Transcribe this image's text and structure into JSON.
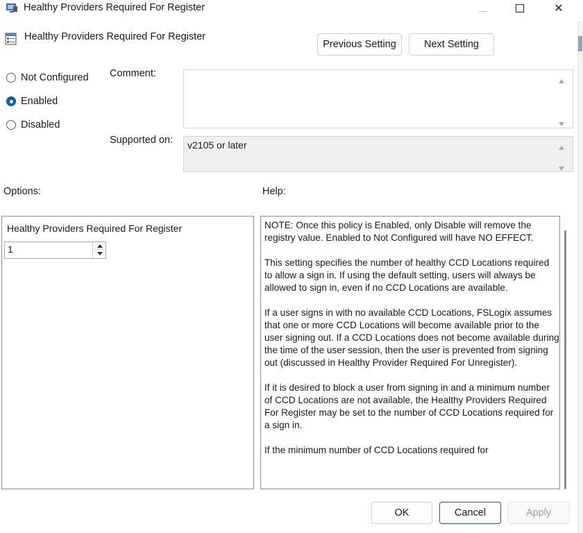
{
  "window": {
    "title": "Healthy Providers Required For Register",
    "icon": "policy-editor-icon",
    "controls": {
      "minimize_icon": "minimize-icon",
      "maximize_icon": "maximize-icon",
      "close_glyph": "✕"
    }
  },
  "header": {
    "policy_title": "Healthy Providers Required For Register",
    "policy_icon": "policy-setting-icon",
    "previous_label": "Previous Setting",
    "next_label": "Next Setting"
  },
  "state": {
    "options": [
      {
        "label": "Not Configured",
        "checked": false
      },
      {
        "label": "Enabled",
        "checked": true
      },
      {
        "label": "Disabled",
        "checked": false
      }
    ]
  },
  "comment": {
    "label": "Comment:",
    "value": ""
  },
  "supported": {
    "label": "Supported on:",
    "value": "v2105 or later"
  },
  "options_pane": {
    "label": "Options:",
    "field_label": "Healthy Providers Required For Register",
    "value": "1"
  },
  "help_pane": {
    "label": "Help:",
    "paragraphs": [
      "NOTE:  Once this policy is Enabled, only Disable will remove the registry value. Enabled to Not Configured will have NO EFFECT.",
      "This setting specifies the number of healthy CCD Locations required to allow a sign in. If using the default setting, users will always be allowed to sign in, even if no CCD Locations are available.",
      "If a user signs in with no available CCD Locations, FSLogix assumes that one or more CCD Locations will become available prior to the user signing out. If a CCD Locations does not become available during the time of the user session, then the user is prevented from signing out (discussed in Healthy Provider Required For Unregister).",
      "If it is desired to block a user from signing in and a minimum number of CCD Locations are not available, the Healthy Providers Required For Register may be set to the number of CCD Locations required for a sign in.",
      "If the minimum number of CCD Locations required for"
    ]
  },
  "footer": {
    "ok_label": "OK",
    "cancel_label": "Cancel",
    "apply_label": "Apply"
  },
  "colors": {
    "accent": "#0a5fb4",
    "disabled_text": "#a0a0a0",
    "readonly_bg": "#f0f0f0"
  }
}
